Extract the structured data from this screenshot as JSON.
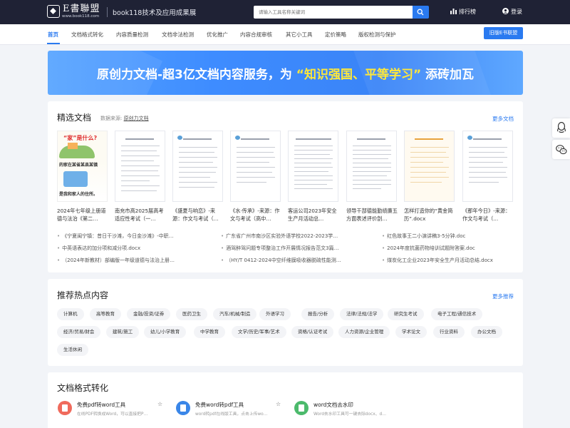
{
  "header": {
    "logo_name": "E書聯盟",
    "logo_url": "www.book118.com",
    "site_title": "book118技术及应用成果展",
    "search_placeholder": "请输入工具名称关键词",
    "rank_label": "排行榜",
    "login_label": "登录"
  },
  "nav": {
    "items": [
      "首页",
      "文档格式转化",
      "内容质量检测",
      "文档非法检测",
      "优化推广",
      "内容合规审核",
      "其它小工具",
      "定价策略",
      "版权检测与保护"
    ],
    "active": "首页",
    "old_alliance": "旧版E书联盟"
  },
  "banner": {
    "text_before": "原创力文档-超3亿文档内容服务，为",
    "highlight": "“知识强国、平等学习”",
    "text_after": "添砖加瓦"
  },
  "featured": {
    "title": "精选文档",
    "source_label": "数据来源:",
    "source_link": "原创力文档",
    "more": "更多文档",
    "cover_text": {
      "title": "“家”是什么?",
      "line1": "的家在某省某县某镇",
      "line2": "是我和家人的住所。"
    },
    "docs": [
      "2024年七年级上册道德与法治《第二…",
      "南充市高2025届高考适应性考试（一…",
      "《盛夏与响恋》-来源：作文与考试（…",
      "《水·传承》-来源：作文与考试（高中…",
      "客运公司2023年安全生产月活动总…",
      "领导干部德能勤绩廉五方面表述评价剖…",
      "怎样打造你的“黄金简历”.docx",
      "《那年今日》-来源：作文与考试（…"
    ],
    "links": [
      [
        "《宁夏闽宁镇：昔日干沙滩，今日金沙滩》-中职…",
        "广东省广州市南沙区实验外语学校2022-2023学…",
        "红色故事王二小演讲稿3-5分钟.doc"
      ],
      [
        "中英语表达的加分项和减分项.docx",
        "酒驾醉驾问题专项整治工作开展情况报告范文3篇…",
        "2024年度抗菌药物培训试题附答案.doc"
      ],
      [
        "（2024年新教材）部编版一年级道德与法治上册…",
        "（HY/T 0412-2024中空纤维膜吸收器脱硫性能测…",
        "煤炭化工企业2023年安全生产月活动总结.docx"
      ]
    ]
  },
  "hot": {
    "title": "推荐热点内容",
    "more": "更多推荐",
    "tags": [
      [
        "计算机",
        "高等教育",
        "金融/投资/证券",
        "医药卫生",
        "汽车/机械/制造",
        "外语学习",
        "报告/分析",
        "法律/法规/法学",
        "研究生考试",
        "电子工程/通信技术"
      ],
      [
        "经济/贸易/财会",
        "建筑/施工",
        "幼儿/小学教育",
        "中学教育",
        "文学/历史/军事/艺术",
        "资格/认证考试",
        "人力资源/企业管理",
        "学术论文",
        "行业资料",
        "办公文档"
      ],
      [
        "生活休闲"
      ]
    ]
  },
  "convert": {
    "title": "文档格式转化",
    "tools": [
      {
        "name": "免费pdf转word工具",
        "desc": "在线PDF转换成Word，可以直接把P…",
        "color": "#f06a5c"
      },
      {
        "name": "免费word转pdf工具",
        "desc": "word转pdf在线版工具，点击上传wo…",
        "color": "#3a86e8"
      },
      {
        "name": "word文档去水印",
        "desc": "Word去水印工具可一键去除docx、d…",
        "color": "#4cba6c"
      }
    ]
  }
}
